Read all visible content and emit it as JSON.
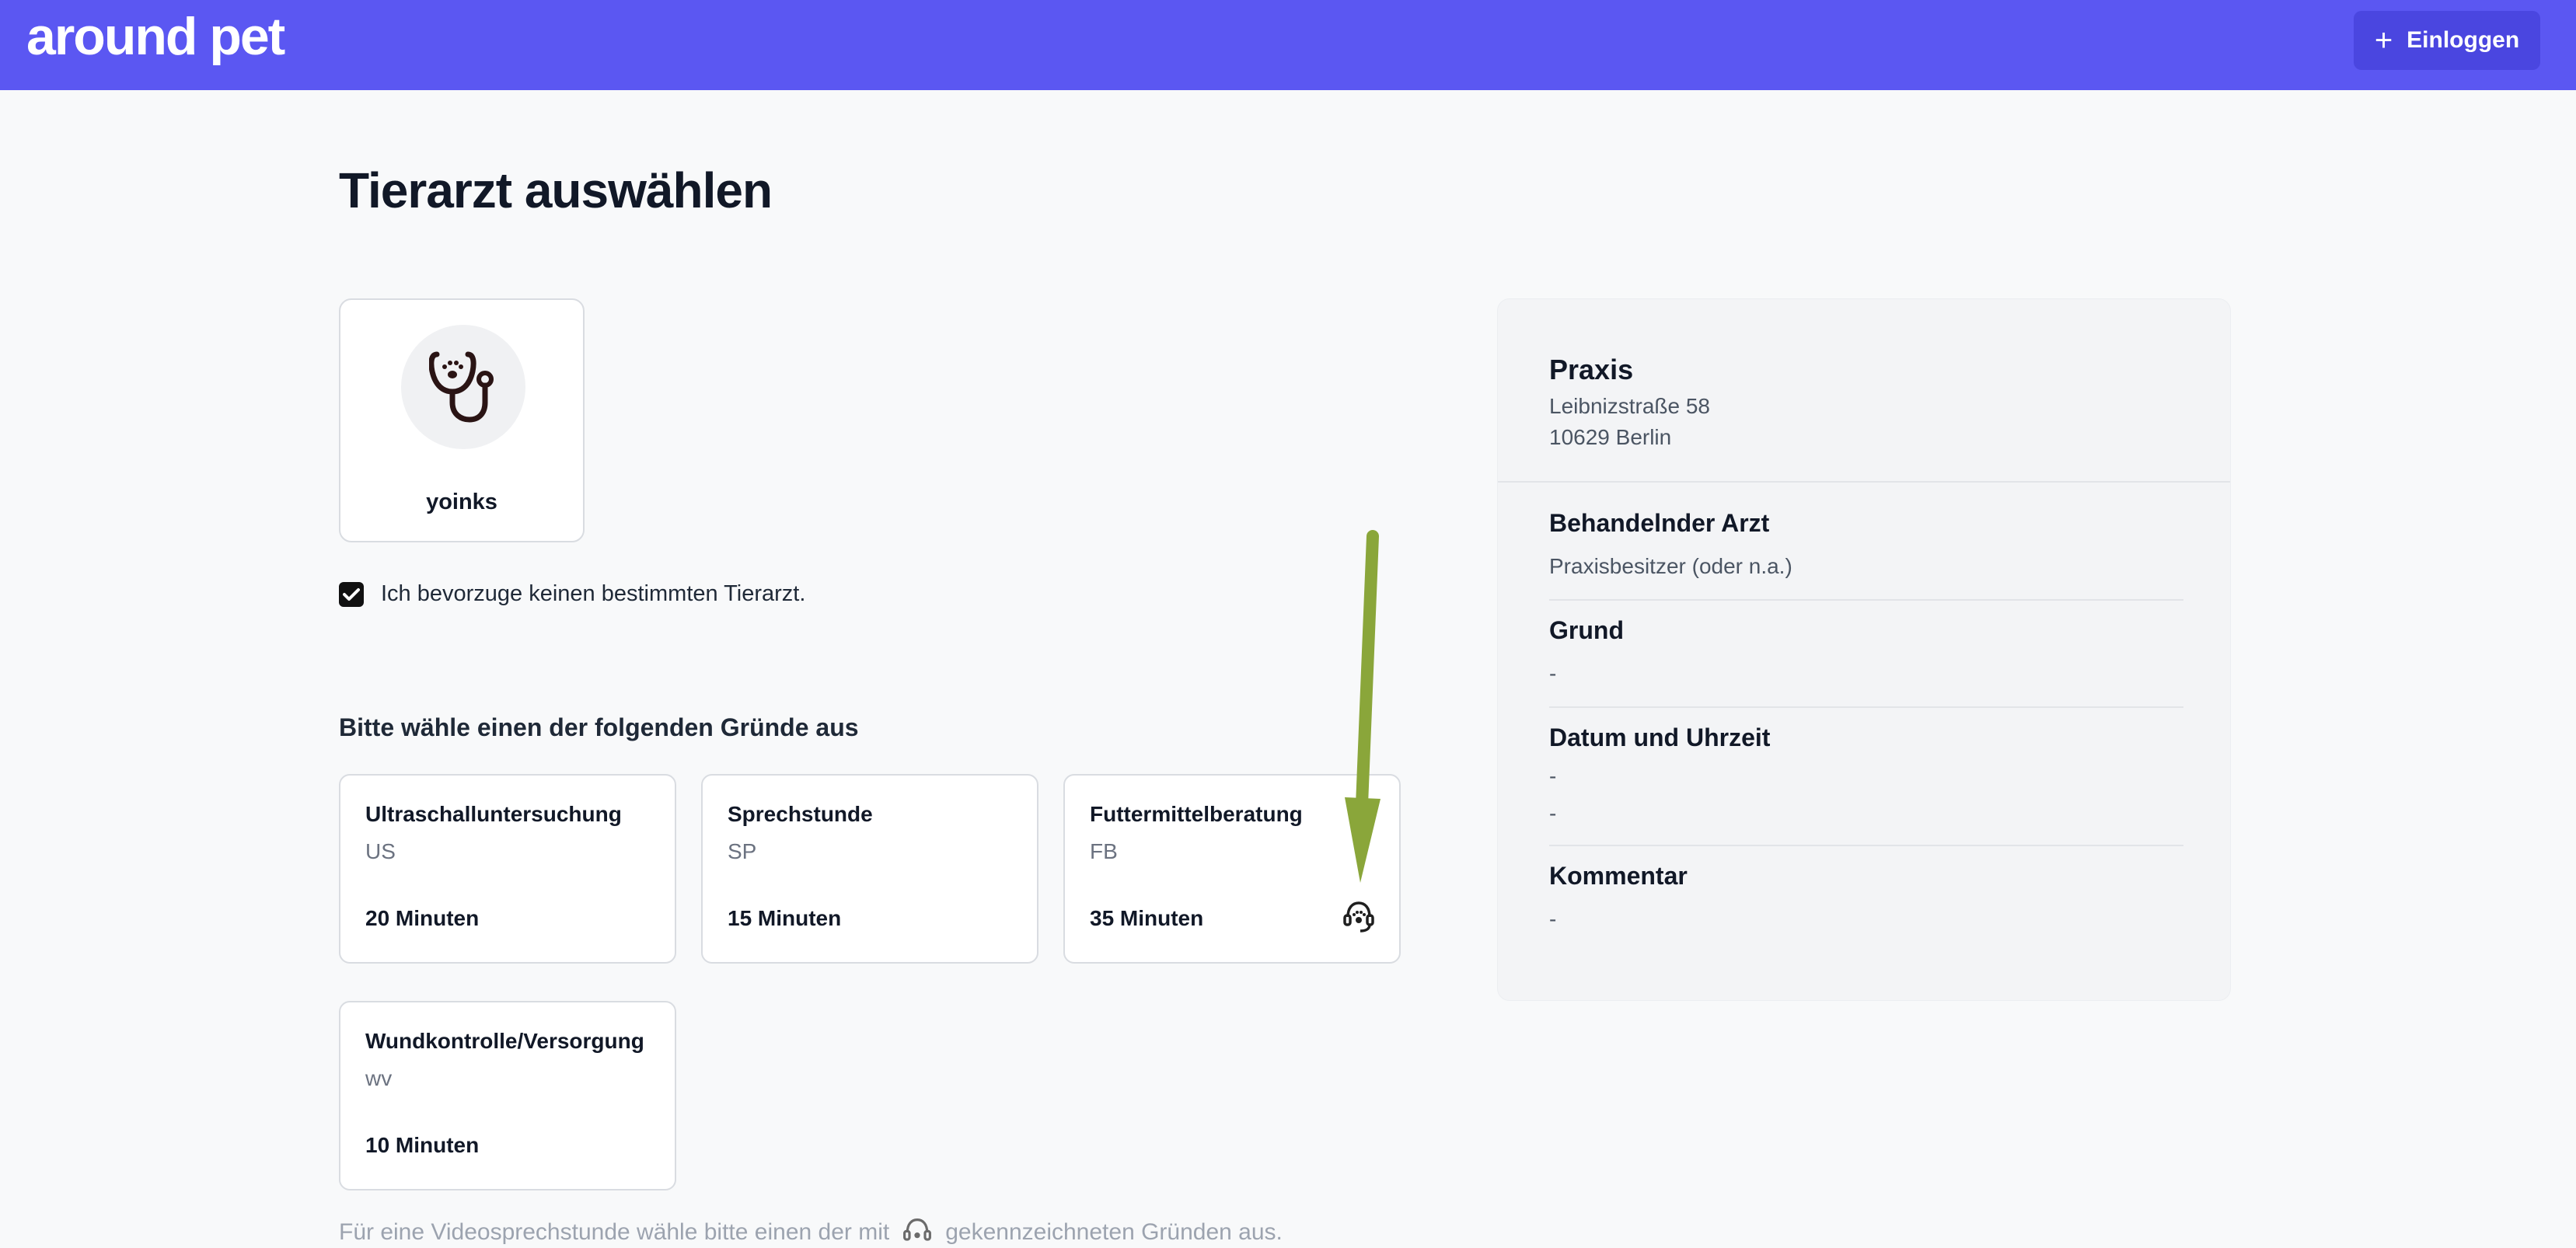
{
  "header": {
    "logo": "around pet",
    "login_label": "Einloggen",
    "brand_color": "#5b57f2"
  },
  "page": {
    "title": "Tierarzt auswählen"
  },
  "vet": {
    "name": "yoinks",
    "icon": "stethoscope-icon"
  },
  "preference": {
    "checked": true,
    "label": "Ich bevorzuge keinen bestimmten Tierarzt."
  },
  "reasons": {
    "heading": "Bitte wähle einen der folgenden Gründe aus",
    "items": [
      {
        "name": "Ultraschalluntersuchung",
        "code": "US",
        "duration": "20 Minuten",
        "video": false
      },
      {
        "name": "Sprechstunde",
        "code": "SP",
        "duration": "15 Minuten",
        "video": false
      },
      {
        "name": "Futtermittelberatung",
        "code": "FB",
        "duration": "35 Minuten",
        "video": true
      },
      {
        "name": "Wundkontrolle/Versorgung",
        "code": "wv",
        "duration": "10 Minuten",
        "video": false
      }
    ],
    "hint_before": "Für eine Videosprechstunde wähle bitte einen der mit",
    "hint_after": "gekennzeichneten Gründen aus."
  },
  "annotation": {
    "arrow_color": "#8aa63a"
  },
  "summary": {
    "practice_title": "Praxis",
    "street": "Leibnizstraße 58",
    "city": "10629 Berlin",
    "doctor_heading": "Behandelnder Arzt",
    "doctor_value": "Praxisbesitzer (oder n.a.)",
    "reason_heading": "Grund",
    "reason_value": "-",
    "datetime_heading": "Datum und Uhrzeit",
    "date_value": "-",
    "time_value": "-",
    "comment_heading": "Kommentar",
    "comment_value": "-"
  }
}
